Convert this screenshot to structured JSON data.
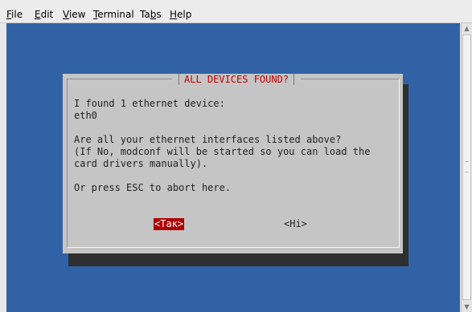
{
  "menu": {
    "items": [
      {
        "accel": "F",
        "rest": "ile"
      },
      {
        "accel": "E",
        "rest": "dit"
      },
      {
        "accel": "V",
        "rest": "iew"
      },
      {
        "accel": "T",
        "rest": "erminal"
      },
      {
        "pre": "Ta",
        "accel": "b",
        "rest": "s"
      },
      {
        "accel": "H",
        "rest": "elp"
      }
    ]
  },
  "dialog": {
    "title": "ALL DEVICES FOUND?",
    "line1": "I found 1 ethernet device:",
    "line2": "eth0",
    "line3": "Are all your ethernet interfaces listed above?",
    "line4": "(If No, modconf will be started so you can load the",
    "line5": "card drivers manually).",
    "line6": "Or press ESC to abort here.",
    "yes_label": "<Так>",
    "no_label": "<Hi>"
  },
  "colors": {
    "terminal_bg": "#3162a6",
    "dialog_bg": "#c5c5c5",
    "title_color": "#c00000",
    "selected_button_bg": "#b00000"
  },
  "icons": {
    "scroll_up": "chevron-up-icon",
    "scroll_down": "chevron-down-icon"
  }
}
